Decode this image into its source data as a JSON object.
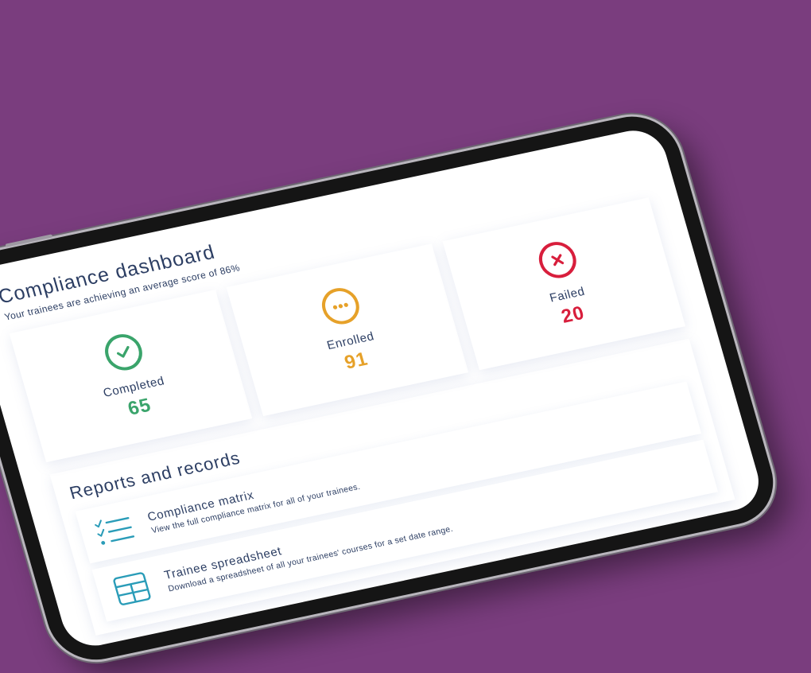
{
  "header": {
    "title": "Compliance dashboard",
    "subtitle": "Your trainees are achieving an average score of 86%"
  },
  "stats": [
    {
      "label": "Completed",
      "value": "65",
      "color": "#3aa46b",
      "icon": "check-icon"
    },
    {
      "label": "Enrolled",
      "value": "91",
      "color": "#e6a129",
      "icon": "ellipsis-icon"
    },
    {
      "label": "Failed",
      "value": "20",
      "color": "#d81e3c",
      "icon": "close-icon"
    }
  ],
  "reports": {
    "title": "Reports and records",
    "items": [
      {
        "title": "Compliance matrix",
        "description": "View the full compliance matrix for all of your trainees.",
        "icon": "checklist-icon"
      },
      {
        "title": "Trainee spreadsheet",
        "description": "Download a spreadsheet of all your trainees' courses for a set date range.",
        "icon": "table-icon"
      }
    ],
    "accent": "#2a9cb8"
  },
  "background": "#7a3d7e"
}
